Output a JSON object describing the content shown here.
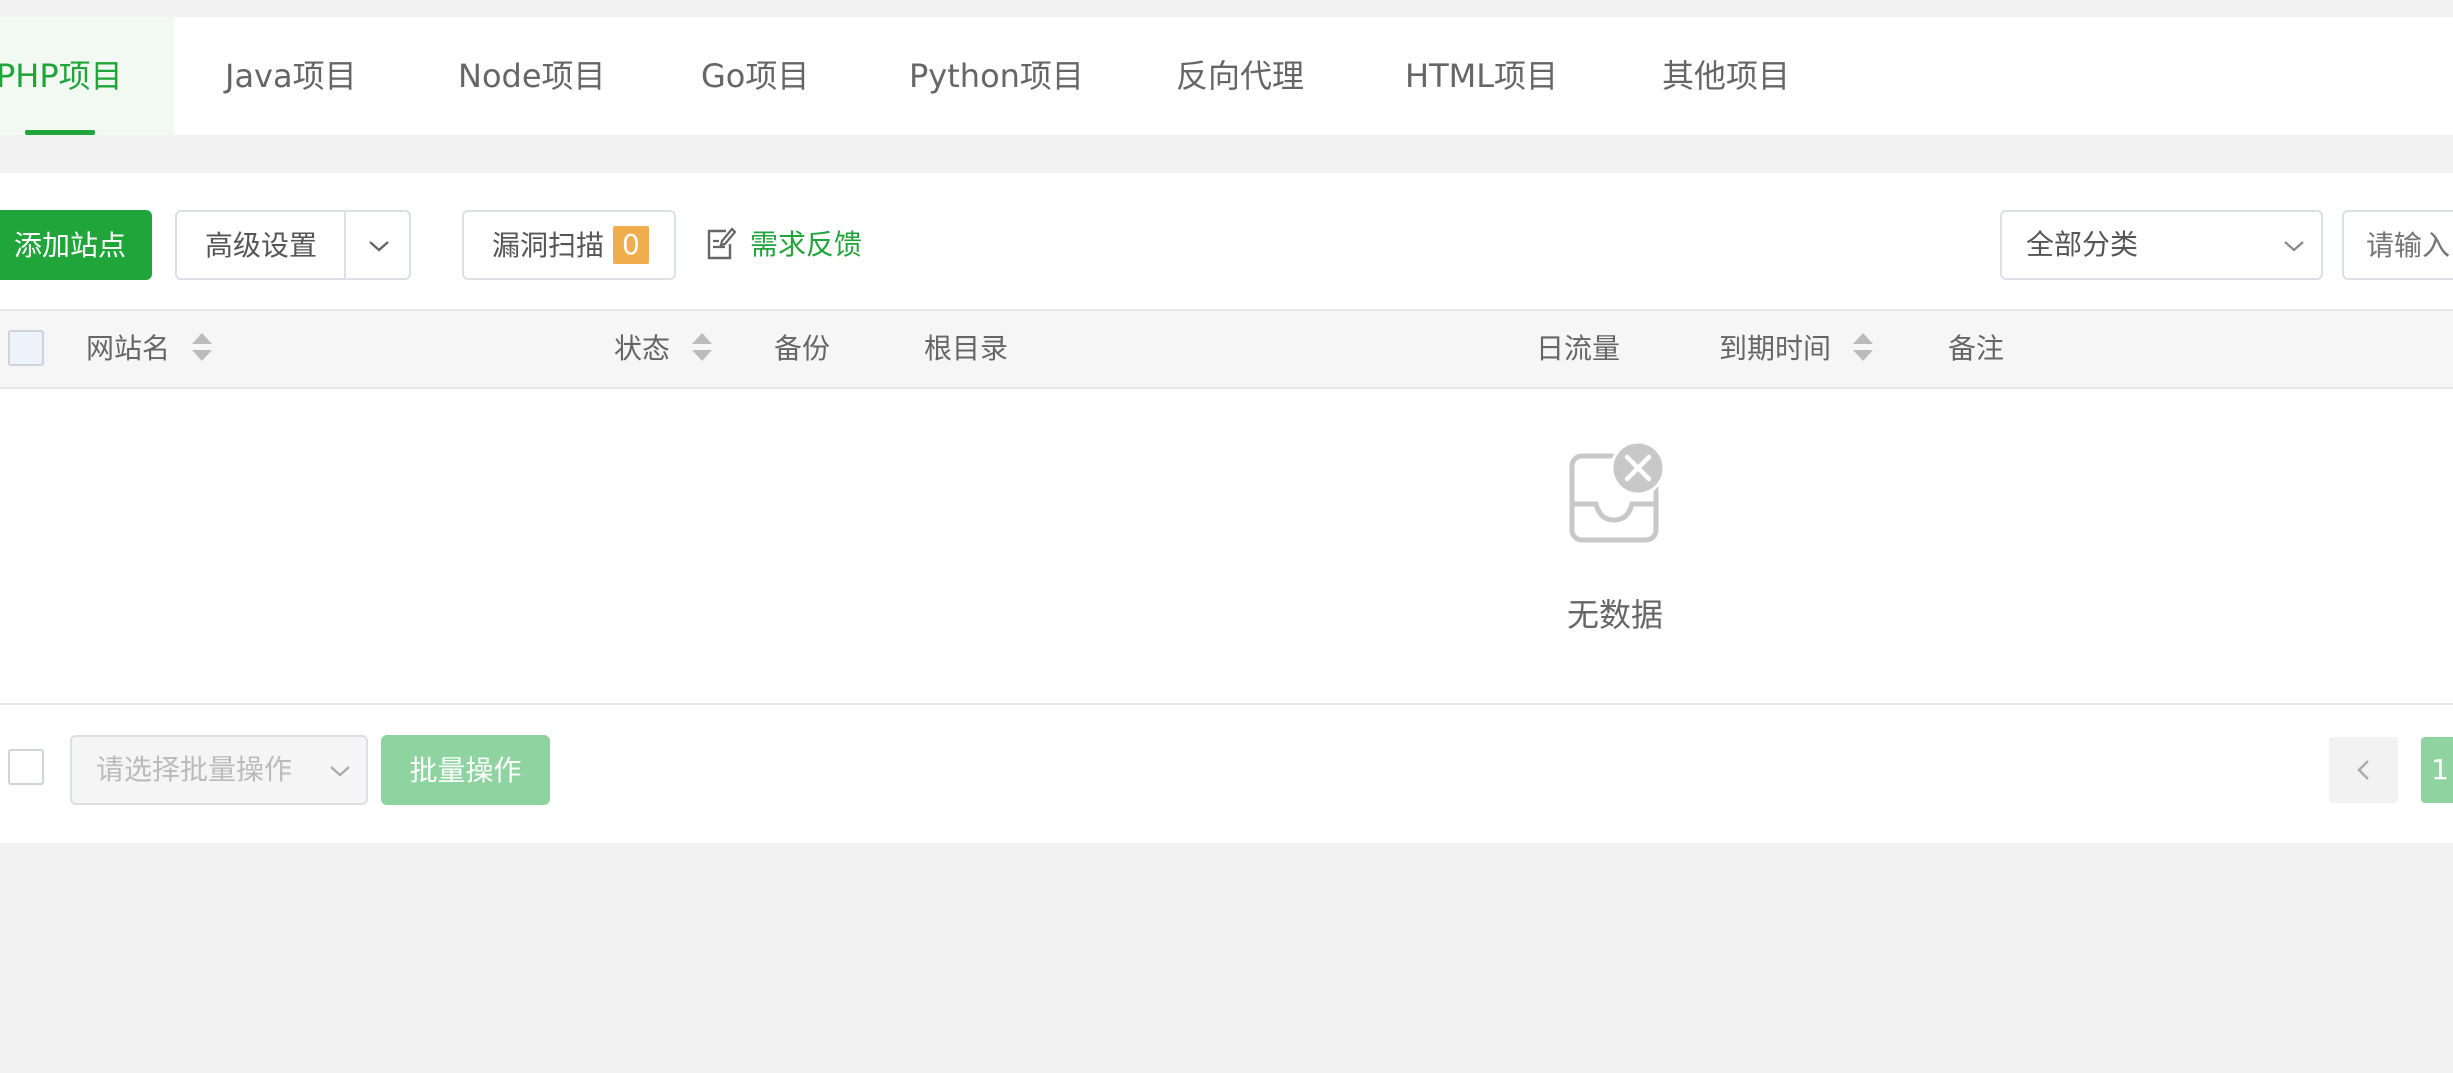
{
  "tabs": [
    {
      "label": "PHP项目",
      "active": true
    },
    {
      "label": "Java项目"
    },
    {
      "label": "Node项目"
    },
    {
      "label": "Go项目"
    },
    {
      "label": "Python项目"
    },
    {
      "label": "反向代理"
    },
    {
      "label": "HTML项目"
    },
    {
      "label": "其他项目"
    }
  ],
  "toolbar": {
    "add_site": "添加站点",
    "advanced": "高级设置",
    "vuln_scan": "漏洞扫描",
    "vuln_count": "0",
    "feedback": "需求反馈",
    "category": "全部分类",
    "search_placeholder": "请输入"
  },
  "table": {
    "columns": [
      "网站名",
      "状态",
      "备份",
      "根目录",
      "日流量",
      "到期时间",
      "备注"
    ],
    "empty_text": "无数据"
  },
  "footer": {
    "batch_placeholder": "请选择批量操作",
    "batch_button": "批量操作",
    "page_current": "1"
  },
  "colors": {
    "accent": "#20a53a",
    "badge": "#f0ad4e",
    "disabled_green": "#8fd3a0"
  }
}
